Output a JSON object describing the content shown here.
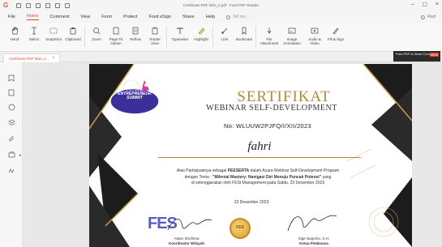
{
  "app": {
    "window_title": "Certificate PDF fahri_2.pdf - Foxit PDF Reader",
    "logo": "G",
    "find_label": "Find"
  },
  "menu": {
    "items": [
      "File",
      "Home",
      "Comment",
      "View",
      "Form",
      "Protect",
      "Foxit eSign",
      "Share",
      "Help"
    ],
    "active": "Home",
    "tell_me": "Tell me..."
  },
  "ribbon": {
    "tools": [
      {
        "label": "Hand",
        "icon": "hand-icon"
      },
      {
        "label": "Select",
        "icon": "select-text-icon"
      },
      {
        "label": "SnapShot",
        "icon": "snapshot-icon"
      },
      {
        "label": "Clipboard",
        "icon": "clipboard-icon"
      },
      {
        "label": "Zoom",
        "icon": "zoom-icon"
      },
      {
        "label": "Page Fit Option",
        "icon": "page-fit-icon"
      },
      {
        "label": "Reflow",
        "icon": "reflow-icon"
      },
      {
        "label": "Rotate View",
        "icon": "rotate-icon"
      },
      {
        "label": "Typewriter",
        "icon": "typewriter-icon"
      },
      {
        "label": "Highlight",
        "icon": "highlight-icon"
      },
      {
        "label": "Link",
        "icon": "link-icon"
      },
      {
        "label": "Bookmark",
        "icon": "bookmark-icon"
      },
      {
        "label": "File Attachment",
        "icon": "file-attachment-icon"
      },
      {
        "label": "Image Annotation",
        "icon": "image-annotation-icon"
      },
      {
        "label": "Audio & Video",
        "icon": "audio-video-icon"
      },
      {
        "label": "Fill & Sign",
        "icon": "fill-sign-icon"
      }
    ]
  },
  "tab": {
    "label": "Certificate PDF fahri_2...",
    "close": "×"
  },
  "promo": {
    "text": "Free PDF to Word Converter",
    "badge": "NEW"
  },
  "certificate": {
    "logo_line1": "FUTURE",
    "logo_line2": "ENTREPRENEUR",
    "logo_line3": "SUMMIT",
    "title": "SERTIFIKAT",
    "subtitle": "WEBINAR SELF-DEVELOPMENT",
    "number": "No: WLUUW2PJFQ/I/XII/2023",
    "recipient": "fahri",
    "body_1": "Atas Partisipasinya sebagai ",
    "body_bold_1": "PEESERTA",
    "body_2": " dalam Acara Webinar Self-Development Program",
    "body_3": "dengan Tema : ",
    "body_bold_2": "\"Milenial Mastery: Navigasi Diri Menuju Puncak Potensi\"",
    "body_4": " yang",
    "body_5": "di selenggarakan oleh FESt Management pada Sabtu, 23 Desember 2023",
    "date": "23 Desember 2023",
    "org": "FES",
    "seal": "FES",
    "sig_left_name": "Adam Shofirma",
    "sig_left_role": "Koordinator Wilayah",
    "sig_right_name": "Sigit Nugroho, S.H.",
    "sig_right_role": "Ketua Pelaksana"
  },
  "colors": {
    "accent": "#e0452c",
    "gold": "#b5893a",
    "dark": "#1c1c1c"
  }
}
